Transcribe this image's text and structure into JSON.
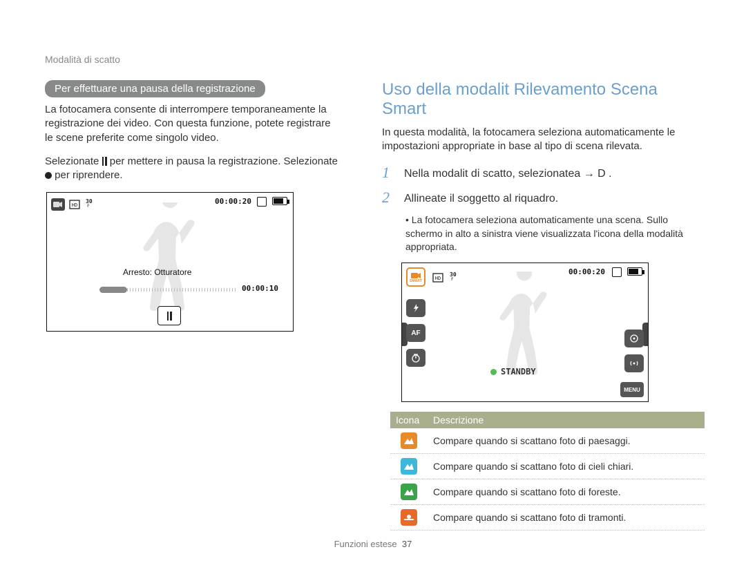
{
  "breadcrumb": "Modalità di scatto",
  "left": {
    "pill": "Per effettuare una pausa della registrazione",
    "para1": "La fotocamera consente di interrompere temporaneamente la registrazione dei video. Con questa funzione, potete registrare le scene preferite come singolo video.",
    "para2_a": "Selezionate ",
    "para2_b": " per mettere in pausa la registrazione. Selezionate ",
    "para2_c": " per riprendere.",
    "screen": {
      "timecode": "00:00:20",
      "stop_label": "Arresto: Otturatore",
      "progress_time": "00:00:10"
    }
  },
  "right": {
    "title": "Uso della modalit  Rilevamento Scena Smart",
    "intro": "In questa modalità, la fotocamera seleziona automaticamente le impostazioni appropriate in base al tipo di scena rilevata.",
    "step1": "Nella modalit  di scatto, selezionatea     → D  .",
    "step2": "Allineate il soggetto al riquadro.",
    "bullet": "La fotocamera seleziona automaticamente una scena. Sullo schermo in alto a sinistra viene visualizzata l'icona della modalità appropriata.",
    "screen": {
      "smart_label": "SMART",
      "timecode": "00:00:20",
      "standby": "STANDBY",
      "af": "AF",
      "menu": "MENU"
    },
    "table": {
      "head_icon": "Icona",
      "head_desc": "Descrizione",
      "rows": [
        {
          "color": "#e88a2a",
          "desc": "Compare quando si scattano foto di paesaggi."
        },
        {
          "color": "#3fb7d9",
          "desc": "Compare quando si scattano foto di cieli chiari."
        },
        {
          "color": "#3aa24b",
          "desc": "Compare quando si scattano foto di foreste."
        },
        {
          "color": "#e86a2a",
          "desc": "Compare quando si scattano foto di tramonti."
        }
      ]
    }
  },
  "footer": {
    "section": "Funzioni estese",
    "page": "37"
  }
}
